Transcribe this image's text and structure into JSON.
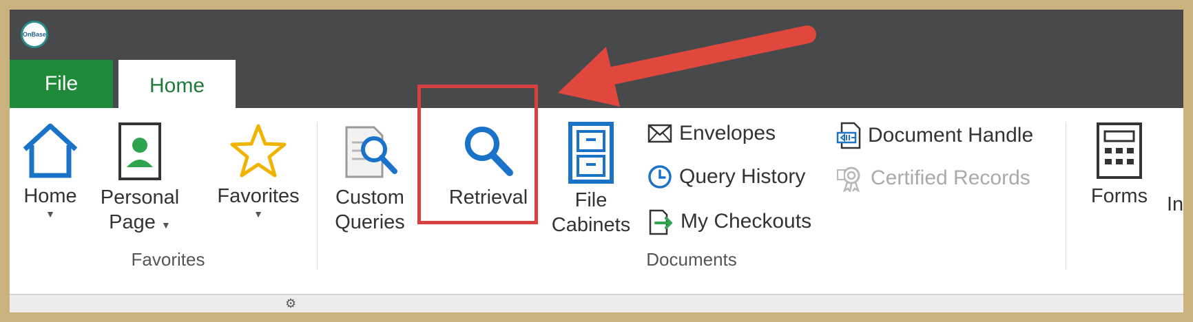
{
  "app": {
    "logo_text": "OnBase"
  },
  "tabs": [
    {
      "label": "File"
    },
    {
      "label": "Home",
      "active": true
    }
  ],
  "ribbon": {
    "favorites_group": {
      "label": "Favorites",
      "buttons": [
        {
          "label": "Home",
          "icon": "house-icon",
          "has_dropdown": true
        },
        {
          "label_line1": "Personal",
          "label_line2": "Page",
          "icon": "person-card-icon",
          "has_dropdown": true
        },
        {
          "label": "Favorites",
          "icon": "star-icon",
          "has_dropdown": true
        }
      ]
    },
    "documents_group": {
      "label": "Documents",
      "large_buttons": [
        {
          "label_line1": "Custom",
          "label_line2": "Queries",
          "icon": "document-search-icon"
        },
        {
          "label": "Retrieval",
          "icon": "magnifier-icon",
          "highlighted": true
        },
        {
          "label_line1": "File",
          "label_line2": "Cabinets",
          "icon": "file-cabinet-icon"
        }
      ],
      "small_buttons": [
        {
          "label": "Envelopes",
          "icon": "envelope-icon",
          "enabled": true
        },
        {
          "label": "Query History",
          "icon": "clock-icon",
          "enabled": true
        },
        {
          "label": "My Checkouts",
          "icon": "checkout-icon",
          "enabled": true
        },
        {
          "label": "Document Handle",
          "icon": "document-handle-icon",
          "enabled": true
        },
        {
          "label": "Certified Records",
          "icon": "certified-seal-icon",
          "enabled": false
        }
      ]
    },
    "forms_group": {
      "buttons": [
        {
          "label": "Forms",
          "icon": "calculator-form-icon"
        },
        {
          "label": "In",
          "icon": ""
        }
      ]
    }
  },
  "annotation": {
    "highlight_color": "#d94040",
    "arrow_color": "#e0483e"
  },
  "colors": {
    "titlebar": "#48494b",
    "file_tab": "#1f8a3a",
    "home_tab_text": "#1f7a3a",
    "icon_blue": "#1a73c8"
  }
}
